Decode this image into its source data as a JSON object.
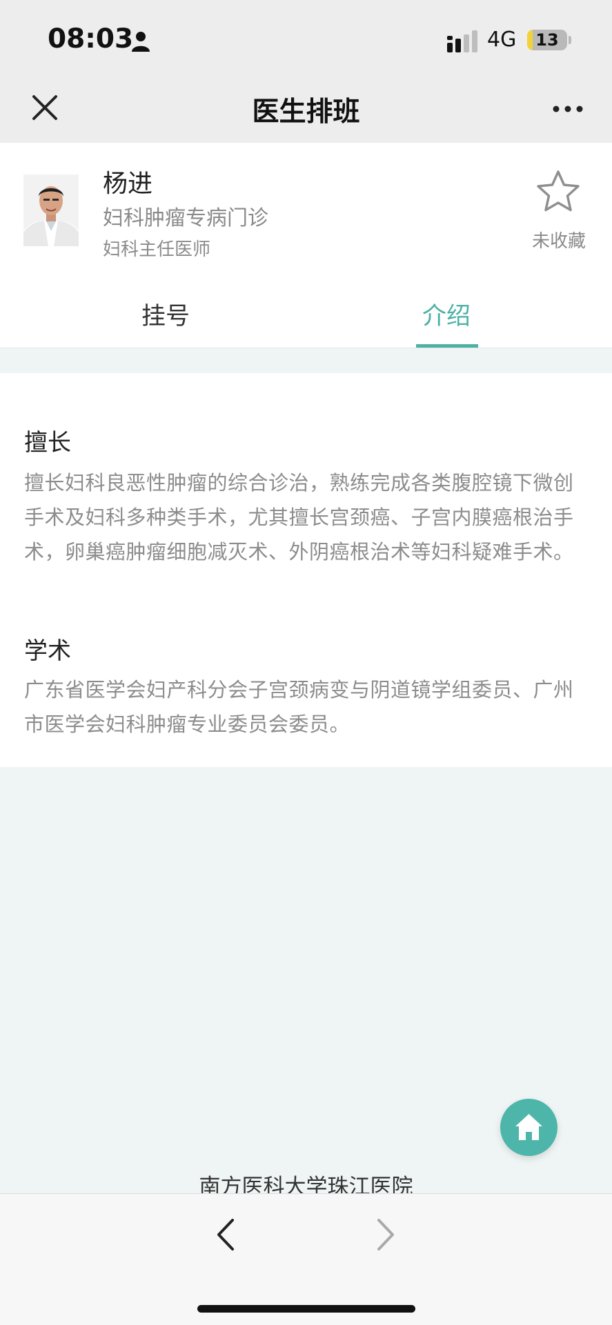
{
  "status_bar": {
    "time": "08:03",
    "network": "4G",
    "battery": "13",
    "battery_level": 0.13
  },
  "nav": {
    "title": "医生排班",
    "close_icon": "close-icon",
    "more_icon": "more-icon"
  },
  "doctor": {
    "name": "杨进",
    "clinic": "妇科肿瘤专病门诊",
    "title": "妇科主任医师",
    "favorite_label": "未收藏"
  },
  "tabs": [
    {
      "label": "挂号",
      "active": false
    },
    {
      "label": "介绍",
      "active": true
    }
  ],
  "intro": {
    "specialty_heading": "擅长",
    "specialty_text": "擅长妇科良恶性肿瘤的综合诊治，熟练完成各类腹腔镜下微创手术及妇科多种类手术，尤其擅长宫颈癌、子宫内膜癌根治手术，卵巢癌肿瘤细胞减灭术、外阴癌根治术等妇科疑难手术。",
    "academic_heading": "学术",
    "academic_text": "广东省医学会妇产科分会子宫颈病变与阴道镜学组委员、广州市医学会妇科肿瘤专业委员会委员。"
  },
  "footer": {
    "hospital": "南方医科大学珠江医院"
  },
  "colors": {
    "accent": "#4db1a6",
    "background": "#eff5f4"
  }
}
